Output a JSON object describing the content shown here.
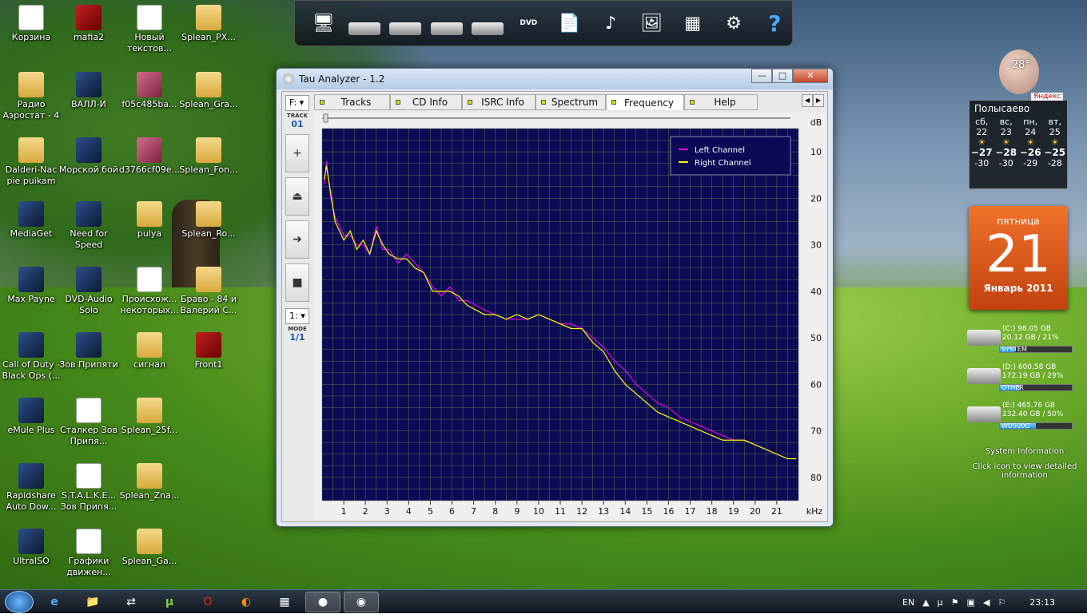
{
  "desktop_icons": [
    {
      "label": "Корзина",
      "kind": "recycle"
    },
    {
      "label": "mafia2",
      "kind": "red"
    },
    {
      "label": "Новый текстов...",
      "kind": "doc"
    },
    {
      "label": "Splean_PX...",
      "kind": "folder"
    },
    {
      "label": "Радио Аэростат - 4",
      "kind": "folder"
    },
    {
      "label": "ВАЛЛ-И",
      "kind": "exe"
    },
    {
      "label": "f05c485ba...",
      "kind": "pink"
    },
    {
      "label": "Splean_Gra...",
      "kind": "folder"
    },
    {
      "label": "Dalderi-Nac pie puikam",
      "kind": "folder"
    },
    {
      "label": "Морской бой",
      "kind": "exe"
    },
    {
      "label": "d3766cf09e...",
      "kind": "pink"
    },
    {
      "label": "Splean_Fon...",
      "kind": "folder"
    },
    {
      "label": "MediaGet",
      "kind": "exe"
    },
    {
      "label": "Need for Speed",
      "kind": "exe"
    },
    {
      "label": "pulya",
      "kind": "folder"
    },
    {
      "label": "Splean_Ro...",
      "kind": "folder"
    },
    {
      "label": "Max Payne",
      "kind": "exe"
    },
    {
      "label": "DVD-Audio Solo",
      "kind": "exe"
    },
    {
      "label": "Происхож... некоторых...",
      "kind": "doc"
    },
    {
      "label": "Браво - 84 и Валерий С...",
      "kind": "folder"
    },
    {
      "label": "Call of Duty - Black Ops (...",
      "kind": "exe"
    },
    {
      "label": "Зов Припяти",
      "kind": "exe"
    },
    {
      "label": "сигнал",
      "kind": "folder"
    },
    {
      "label": "Front1",
      "kind": "red"
    },
    {
      "label": "eMule Plus",
      "kind": "exe"
    },
    {
      "label": "Сталкер Зов Припя...",
      "kind": "doc"
    },
    {
      "label": "Splean_25f...",
      "kind": "folder"
    },
    {
      "label": "Rapidshare Auto Dow...",
      "kind": "exe"
    },
    {
      "label": "S.T.A.L.K.E... Зов Припя...",
      "kind": "doc"
    },
    {
      "label": "Splean_Zna...",
      "kind": "folder"
    },
    {
      "label": "UltraISO",
      "kind": "exe"
    },
    {
      "label": "Графики движен...",
      "kind": "doc"
    },
    {
      "label": "Splean_Ga...",
      "kind": "folder"
    }
  ],
  "launcher": {
    "dvd_label": "DVD",
    "gear": "⚙",
    "help": "?"
  },
  "window": {
    "title": "Tau Analyzer - 1.2",
    "buttons": {
      "minimize": "—",
      "maximize": "□",
      "close": "✕"
    },
    "left": {
      "drive": "F:",
      "track_label": "TRACK",
      "track_num": "01",
      "mode_select": "1:",
      "mode_label": "MODE",
      "mode_value": "1/1",
      "btn_plus": "+",
      "btn_eject": "⏏",
      "btn_next": "➜",
      "btn_stop": "■"
    },
    "tabs": [
      {
        "label": "Tracks"
      },
      {
        "label": "CD Info"
      },
      {
        "label": "ISRC Info"
      },
      {
        "label": "Spectrum"
      },
      {
        "label": "Frequency",
        "active": true
      },
      {
        "label": "Help"
      }
    ]
  },
  "chart_data": {
    "type": "line",
    "xlabel": "kHz",
    "ylabel": "dB",
    "xlim": [
      0,
      22
    ],
    "ylim": [
      5,
      85
    ],
    "y_inverted": true,
    "x_ticks": [
      1,
      2,
      3,
      4,
      5,
      6,
      7,
      8,
      9,
      10,
      11,
      12,
      13,
      14,
      15,
      16,
      17,
      18,
      19,
      20,
      21
    ],
    "y_ticks": [
      10,
      20,
      30,
      40,
      50,
      60,
      70,
      80
    ],
    "legend": "top-right",
    "background": "#0a0a55",
    "grid": true,
    "series": [
      {
        "name": "Left Channel",
        "color": "#e000e0",
        "x": [
          0.1,
          0.2,
          0.4,
          0.6,
          0.8,
          1.0,
          1.3,
          1.6,
          1.9,
          2.2,
          2.5,
          2.8,
          3.1,
          3.5,
          3.9,
          4.3,
          4.7,
          5.1,
          5.5,
          5.9,
          6.3,
          6.7,
          7.1,
          7.5,
          8.0,
          8.5,
          9.0,
          9.5,
          10.0,
          10.5,
          11.0,
          11.5,
          12.0,
          12.5,
          13.0,
          13.5,
          14.0,
          14.5,
          15.0,
          15.5,
          16.0,
          16.5,
          17.0,
          17.5,
          18.0,
          18.5,
          19.0,
          19.5,
          20.0,
          20.5,
          21.0,
          21.5,
          21.9
        ],
        "y": [
          17,
          12,
          20,
          24,
          26,
          28,
          28,
          30,
          30,
          32,
          26,
          31,
          31,
          34,
          32,
          34,
          36,
          39,
          41,
          39,
          42,
          42,
          43,
          44,
          45,
          46,
          46,
          46,
          45,
          46,
          47,
          47,
          48,
          50,
          52,
          55,
          57,
          60,
          62,
          64,
          65,
          67,
          68,
          69,
          70,
          71,
          72,
          72,
          73,
          74,
          75,
          76,
          76
        ]
      },
      {
        "name": "Right Channel",
        "color": "#ffff00",
        "x": [
          0.1,
          0.2,
          0.4,
          0.6,
          0.8,
          1.0,
          1.3,
          1.6,
          1.9,
          2.2,
          2.5,
          2.8,
          3.1,
          3.5,
          3.9,
          4.3,
          4.7,
          5.1,
          5.5,
          5.9,
          6.3,
          6.7,
          7.1,
          7.5,
          8.0,
          8.5,
          9.0,
          9.5,
          10.0,
          10.5,
          11.0,
          11.5,
          12.0,
          12.5,
          13.0,
          13.5,
          14.0,
          14.5,
          15.0,
          15.5,
          16.0,
          16.5,
          17.0,
          17.5,
          18.0,
          18.5,
          19.0,
          19.5,
          20.0,
          20.5,
          21.0,
          21.5,
          21.9
        ],
        "y": [
          16,
          13,
          19,
          25,
          27,
          29,
          27,
          31,
          29,
          32,
          27,
          30,
          32,
          33,
          33,
          35,
          36,
          40,
          40,
          40,
          41,
          43,
          44,
          45,
          45,
          46,
          45,
          46,
          45,
          46,
          47,
          48,
          48,
          51,
          53,
          57,
          60,
          62,
          64,
          66,
          67,
          68,
          69,
          70,
          71,
          72,
          72,
          72,
          73,
          74,
          75,
          76,
          76
        ]
      }
    ]
  },
  "weather": {
    "city": "Полысаево",
    "temp_now": "-28°",
    "brand": "Яндекс",
    "days": [
      {
        "d": "сб,",
        "n": "22",
        "hi": "−27",
        "lo": "-30"
      },
      {
        "d": "вс,",
        "n": "23",
        "hi": "−28",
        "lo": "-30"
      },
      {
        "d": "пн,",
        "n": "24",
        "hi": "−26",
        "lo": "-29"
      },
      {
        "d": "вт,",
        "n": "25",
        "hi": "−25",
        "lo": "-28"
      }
    ]
  },
  "calendar": {
    "weekday": "пятница",
    "day": "21",
    "month": "Январь 2011"
  },
  "drives": [
    {
      "title": "(C:) 98.05 GB",
      "info": "20.12 GB / 21%",
      "label": "SYSTEM",
      "pct": 21
    },
    {
      "title": "(D:) 600.58 GB",
      "info": "172.19 GB / 29%",
      "label": "OTHER",
      "pct": 29
    },
    {
      "title": "(E:) 465.76 GB",
      "info": "232.40 GB / 50%",
      "label": "WD500G",
      "pct": 50
    }
  ],
  "sysinfo": {
    "title": "System Information",
    "hint": "Click icon to view detailed information"
  },
  "taskbar": {
    "lang": "EN",
    "time": "23:13"
  }
}
